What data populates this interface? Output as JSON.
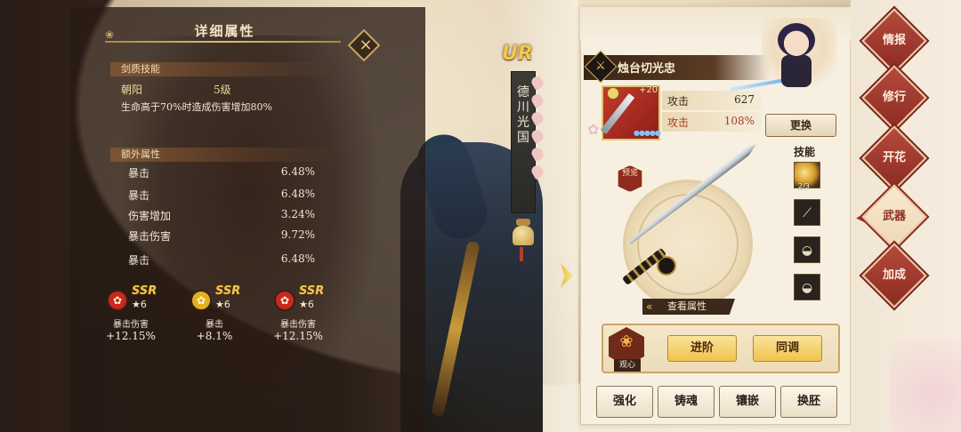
{
  "detail_panel": {
    "title": "详细属性",
    "close_icon": "×",
    "sword_skill": {
      "header": "剑质技能",
      "name": "朝阳",
      "level": "5级",
      "description": "生命高于70%时造成伤害增加80%"
    },
    "extra_attrs": {
      "header": "额外属性",
      "rows": [
        {
          "label": "暴击",
          "value": "6.48%"
        },
        {
          "label": "暴击",
          "value": "6.48%"
        },
        {
          "label": "伤害增加",
          "value": "3.24%"
        },
        {
          "label": "暴击伤害",
          "value": "9.72%"
        },
        {
          "label": "暴击",
          "value": "6.48%"
        }
      ]
    },
    "cards": [
      {
        "rarity": "SSR",
        "stars": "★6",
        "orb_color": "#c8281e",
        "glyph": "✿",
        "name": "暴击伤害",
        "value": "+12.15%"
      },
      {
        "rarity": "SSR",
        "stars": "★6",
        "orb_color": "#e0b21e",
        "glyph": "✿",
        "name": "暴击",
        "value": "+8.1%"
      },
      {
        "rarity": "SSR",
        "stars": "★6",
        "orb_color": "#c8281e",
        "glyph": "✿",
        "name": "暴击伤害",
        "value": "+12.15%"
      }
    ]
  },
  "character": {
    "rarity": "UR",
    "name_vertical": "德川光国"
  },
  "weapon_panel": {
    "weapon_name": "烛台切光忠",
    "weapon_icon": "⚔",
    "refine_plus": "+20",
    "drops": "●●●●●",
    "attrs": [
      {
        "label": "攻击",
        "value": "627"
      },
      {
        "label": "攻击",
        "value": "108%"
      }
    ],
    "swap_label": "更换",
    "preview_label": "预览",
    "view_attrs_label": "查看属性",
    "skills_label": "技能",
    "skill_count": "2/3",
    "awaken": {
      "lotus_label": "观心",
      "advance_label": "进阶",
      "tune_label": "同调"
    },
    "bottom_buttons": [
      "强化",
      "铸魂",
      "镶嵌",
      "换胚"
    ]
  },
  "nav": {
    "items": [
      {
        "label": "情报",
        "active": false
      },
      {
        "label": "修行",
        "active": false
      },
      {
        "label": "开花",
        "active": false
      },
      {
        "label": "武器",
        "active": true
      },
      {
        "label": "加成",
        "active": false
      }
    ]
  },
  "colors": {
    "accent_red": "#8c2b22",
    "gold": "#f0c34e",
    "panel_bg": "#f7f0e1"
  }
}
